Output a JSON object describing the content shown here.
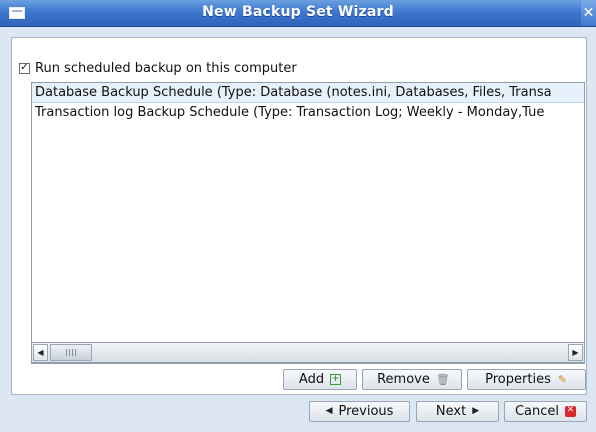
{
  "window": {
    "title": "New Backup Set Wizard",
    "close_glyph": "✕",
    "icon": "window-icon"
  },
  "options": {
    "run_scheduled": {
      "label": "Run scheduled backup on this computer",
      "checked": true,
      "check_glyph": "✓"
    }
  },
  "schedules": [
    {
      "text": "Database Backup Schedule (Type: Database (notes.ini, Databases, Files, Transa",
      "selected": true
    },
    {
      "text": "Transaction log Backup Schedule (Type: Transaction Log; Weekly - Monday,Tue",
      "selected": false
    }
  ],
  "scrollbar": {
    "left_glyph": "◀",
    "right_glyph": "▶"
  },
  "actions": {
    "add": {
      "label": "Add",
      "icon": "add-icon",
      "glyph": "+"
    },
    "remove": {
      "label": "Remove",
      "icon": "trash-icon",
      "glyph": "🗑"
    },
    "properties": {
      "label": "Properties",
      "icon": "edit-icon",
      "glyph": "✎"
    }
  },
  "navigation": {
    "previous": {
      "label": "Previous",
      "glyph": "◀"
    },
    "next": {
      "label": "Next",
      "glyph": "▶"
    },
    "cancel": {
      "label": "Cancel",
      "glyph": "✕"
    }
  },
  "colors": {
    "titlebar": "#3f78cf",
    "background": "#dde7f3",
    "selection": "#e6f1fb",
    "cancel_icon": "#d8272d"
  }
}
